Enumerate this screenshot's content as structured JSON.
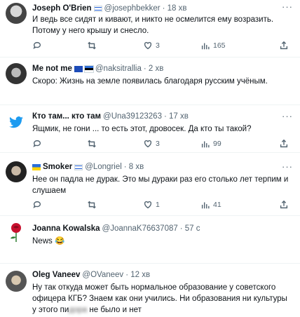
{
  "tweets": [
    {
      "name": "Joseph O'Brien",
      "flags": [
        "il"
      ],
      "handle": "@josephbekker",
      "time": "· 18 хв",
      "text": "И ведь все сидят и кивают, и никто не осмелится ему возразить. Потому у него крышу и снесло.",
      "replies": "",
      "retweets": "",
      "likes": "3",
      "views": "165",
      "avatar": "portrait-photo"
    },
    {
      "name": "Me not me",
      "flags": [
        "eu",
        "ee"
      ],
      "handle": "@naksitrallia",
      "time": "· 2 хв",
      "text": "Скоро: Жизнь на земле появилась благодаря русским учёным.",
      "replies": "",
      "retweets": "",
      "likes": "",
      "views": "",
      "avatar": "portrait-photo"
    },
    {
      "name": "Кто там... кто там",
      "flags": [],
      "handle": "@Una39123263",
      "time": "· 17 хв",
      "text": "Ящмик, не гони ... то есть этот, дровосек. Да кто ты такой?",
      "replies": "",
      "retweets": "",
      "likes": "3",
      "views": "99",
      "avatar": "twitter-bird"
    },
    {
      "name": "Smoker",
      "flags": [
        "ua_before",
        "il"
      ],
      "handle": "@Longriel",
      "time": "· 8 хв",
      "text": "Нее он падла не дурак. Это мы дураки раз его столько лет терпим и слушаем",
      "replies": "",
      "retweets": "",
      "likes": "1",
      "views": "41",
      "avatar": "portrait-photo"
    },
    {
      "name": "Joanna Kowalska",
      "flags": [],
      "handle": "@JoannaK76637087",
      "time": "· 57 с",
      "text": "News 😂",
      "replies": "",
      "retweets": "",
      "likes": "",
      "views": "",
      "avatar": "rose"
    },
    {
      "name": "Oleg Vaneev",
      "flags": [],
      "handle": "@OVaneev",
      "time": "· 12 хв",
      "text": "Ну так откуда может быть нормальное образование у советского офицера КГБ? Знаем как они учились.  Ни образования ни культуры у этого пи",
      "text_blurred": "дора",
      "text_end": " не было и нет",
      "avatar": "portrait-photo"
    }
  ],
  "colors": {
    "accent": "#1d9bf0",
    "muted": "#536471",
    "divider": "#eff3f4"
  },
  "icons": {
    "reply": "reply-icon",
    "retweet": "retweet-icon",
    "like": "heart-icon",
    "views": "views-icon",
    "share": "share-icon",
    "more": "more-icon"
  }
}
